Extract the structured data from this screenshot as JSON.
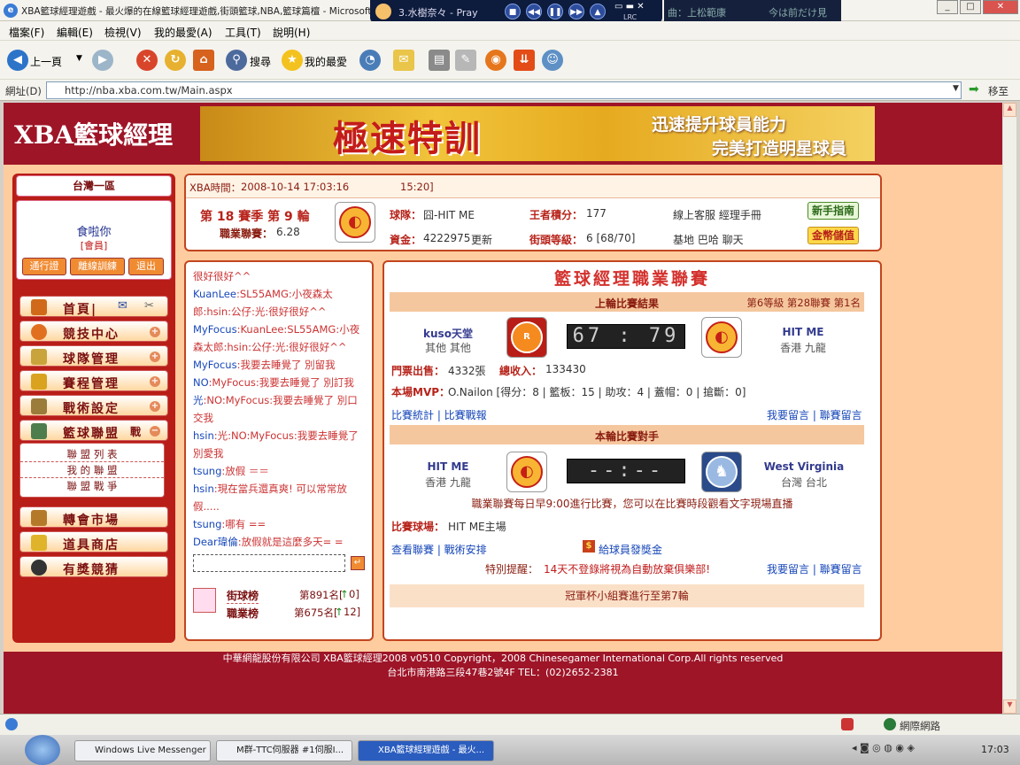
{
  "window": {
    "title": "XBA籃球經理遊戲 - 最火爆的在線籃球經理遊戲,街頭籃球,NBA,籃球篇檀 - Microsoft Inte",
    "media_track": "3.水樹奈々 - Pray",
    "media_brand": "LRC",
    "lyric_left": "曲：上松範康",
    "lyric_right": "今は前だけ見"
  },
  "menu": [
    "檔案(F)",
    "編輯(E)",
    "檢視(V)",
    "我的最愛(A)",
    "工具(T)",
    "說明(H)"
  ],
  "toolbar": {
    "back": "上一頁",
    "search": "搜尋",
    "favorites": "我的最愛"
  },
  "address": {
    "label": "網址(D)",
    "url": "http://nba.xba.com.tw/Main.aspx",
    "go": "移至"
  },
  "site": {
    "logo": "XBA籃球經理",
    "banner_big": "極速特訓",
    "banner_s1": "迅速提升球員能力",
    "banner_s2": "完美打造明星球員"
  },
  "left": {
    "server": "台灣一區",
    "user": "食啦你",
    "role": "[會員]",
    "btn_pass": "通行證",
    "btn_train": "離線訓練",
    "btn_logout": "退出",
    "nav": [
      {
        "label": "首頁|"
      },
      {
        "label": "競技中心"
      },
      {
        "label": "球隊管理"
      },
      {
        "label": "賽程管理"
      },
      {
        "label": "戰術設定"
      },
      {
        "label": "籃球聯盟"
      },
      {
        "label": "轉會市場"
      },
      {
        "label": "道具商店"
      },
      {
        "label": "有獎競猜"
      }
    ],
    "league_war_label": "戰",
    "league_sub": [
      "聯 盟 列 表",
      "我 的 聯 盟",
      "聯 盟 戰 爭"
    ]
  },
  "info": {
    "time_label": "XBA時間：",
    "time": "2008-10-14 17:03:16",
    "clock": "15:20]",
    "season": "第 18 賽季 第 9 輪",
    "league_label": "職業聯賽：",
    "league_val": "6.28",
    "team_label": "球隊：",
    "team_val": "囧-HIT ME",
    "points_label": "王者積分：",
    "points_val": "177",
    "links1": "線上客服  經理手冊",
    "btn_guide": "新手指南",
    "money_label": "資金：",
    "money_val": "4222975",
    "refresh": "更新",
    "level_label": "街頭等級：",
    "level_val": "6 [68/70]",
    "links2": "基地  巴哈  聊天",
    "btn_gold": "金幣儲值"
  },
  "chat": {
    "lines": [
      {
        "name": "",
        "text": "很好很好^^"
      },
      {
        "name": "KuanLee",
        "text": ":SL55AMG:小夜森太郎:hsin:公仔:光:很好很好^^"
      },
      {
        "name": "MyFocus",
        "text": ":KuanLee:SL55AMG:小夜森太郎:hsin:公仔:光:很好很好^^"
      },
      {
        "name": "MyFocus",
        "text": ":我要去睡覺了 別留我"
      },
      {
        "name": "NO",
        "text": ":MyFocus:我要去睡覺了 別訂我"
      },
      {
        "name": "光",
        "text": ":NO:MyFocus:我要去睡覺了 別口交我"
      },
      {
        "name": "hsin",
        "text": ":光:NO:MyFocus:我要去睡覺了 別愛我"
      },
      {
        "name": "tsung",
        "text": ":放假 ＝＝"
      },
      {
        "name": "hsin",
        "text": ":現在當兵還真爽! 可以常常放假....."
      },
      {
        "name": "tsung",
        "text": ":哪有 =="
      },
      {
        "name": "Dear瑋倫",
        "text": ":放假就是這麼多天= ="
      }
    ],
    "rank1_label": "街球榜",
    "rank1_val": "第891名[",
    "rank1_delta": "0]",
    "rank2_label": "職業榜",
    "rank2_val": "第675名[",
    "rank2_delta": "12]"
  },
  "league": {
    "title": "籃球經理職業聯賽",
    "last_result": "上輪比賽結果",
    "last_meta": "第6等級 第28聯賽 第1名",
    "home_team": "kuso天堂",
    "home_loc": "其他 其他",
    "score": "67 : 79",
    "away_team": "HIT ME",
    "away_loc": "香港 九龍",
    "tickets_label": "門票出售：",
    "tickets_val": "4332張",
    "income_label": "總收入：",
    "income_val": "133430",
    "mvp_label": "本場MVP：",
    "mvp_val": "O.Nailon [得分：8 | 籃板：15 | 助攻：4 | 蓋帽：0 | 搶斷：0]",
    "stats_link": "比賽統計 | 比賽戰報",
    "msg_link": "我要留言 | 聯賽留言",
    "next_opp": "本輪比賽對手",
    "next_home": "HIT ME",
    "next_home_loc": "香港 九龍",
    "next_score": "--:--",
    "next_away": "West Virginia",
    "next_away_loc": "台灣 台北",
    "schedule_note": "職業聯賽每日早9:00進行比賽，您可以在比賽時段觀看文字現場直播",
    "venue_label": "比賽球場：",
    "venue_val": "HIT ME主場",
    "links3": "查看聯賽 | 戰術安排",
    "bonus": "給球員發獎金",
    "warn_label": "特別提醒：",
    "warn_val": "14天不登錄將視為自動放棄俱樂部!",
    "msg_link2": "我要留言 | 聯賽留言",
    "cup_note": "冠軍杯小組賽進行至第7輪"
  },
  "footer": {
    "line1": "中華網龍股份有限公司  XBA籃球經理2008 v0510     Copyright，2008 Chinesegamer International Corp.All rights reserved",
    "line2": "台北市南港路三段47巷2號4F TEL：(02)2652-2381"
  },
  "status": {
    "zone": "網際網路"
  },
  "taskbar": {
    "items": [
      "Windows Live Messenger",
      "M群-TTC伺服器 #1伺服I...",
      "XBA籃球經理遊戲 - 最火..."
    ],
    "clock": "17:03"
  }
}
